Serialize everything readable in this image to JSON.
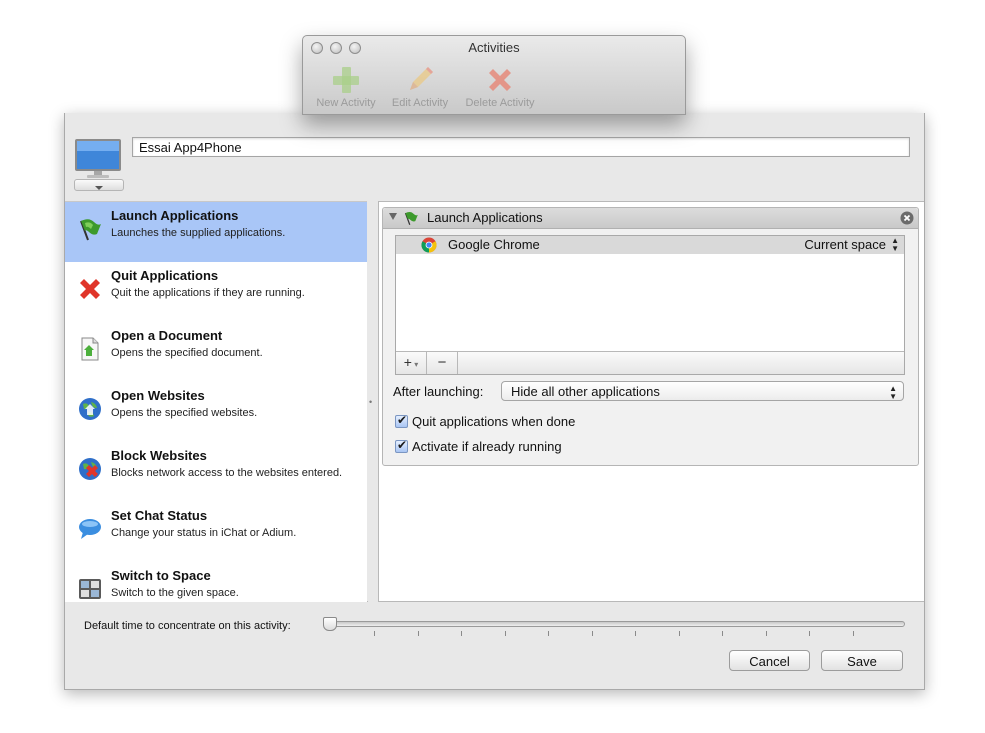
{
  "toolbar_window": {
    "title": "Activities",
    "buttons": [
      {
        "label": "New Activity",
        "icon": "plus-icon"
      },
      {
        "label": "Edit Activity",
        "icon": "pencil-icon"
      },
      {
        "label": "Delete Activity",
        "icon": "delete-x-icon"
      }
    ]
  },
  "activity": {
    "name": "Essai App4Phone"
  },
  "action_list": [
    {
      "title": "Launch Applications",
      "description": "Launches the supplied applications.",
      "icon": "green-flag-icon",
      "selected": true
    },
    {
      "title": "Quit Applications",
      "description": "Quit the applications if they are running.",
      "icon": "red-x-icon",
      "selected": false
    },
    {
      "title": "Open a Document",
      "description": "Opens the specified document.",
      "icon": "document-icon",
      "selected": false
    },
    {
      "title": "Open Websites",
      "description": "Opens the specified websites.",
      "icon": "globe-icon",
      "selected": false
    },
    {
      "title": "Block Websites",
      "description": "Blocks network access to the websites entered.",
      "icon": "block-globe-icon",
      "selected": false
    },
    {
      "title": "Set Chat Status",
      "description": "Change your status in iChat or Adium.",
      "icon": "chat-bubble-icon",
      "selected": false
    },
    {
      "title": "Switch to Space",
      "description": "Switch to the given space.",
      "icon": "spaces-icon",
      "selected": false
    }
  ],
  "launch_panel": {
    "title": "Launch Applications",
    "apps": [
      {
        "name": "Google Chrome",
        "space": "Current space",
        "icon": "chrome-icon"
      }
    ],
    "add_label": "+",
    "remove_label": "−",
    "after_launching_label": "After launching:",
    "after_launching_value": "Hide all other applications",
    "quit_when_done_label": "Quit applications when done",
    "quit_when_done": true,
    "activate_if_running_label": "Activate if already running",
    "activate_if_running": true
  },
  "footer": {
    "slider_label": "Default time to concentrate on this activity:",
    "slider_value_fraction": 0.0,
    "cancel_label": "Cancel",
    "save_label": "Save"
  },
  "colors": {
    "selection": "#a9c6f7",
    "window_bg": "#e8e8e8"
  }
}
